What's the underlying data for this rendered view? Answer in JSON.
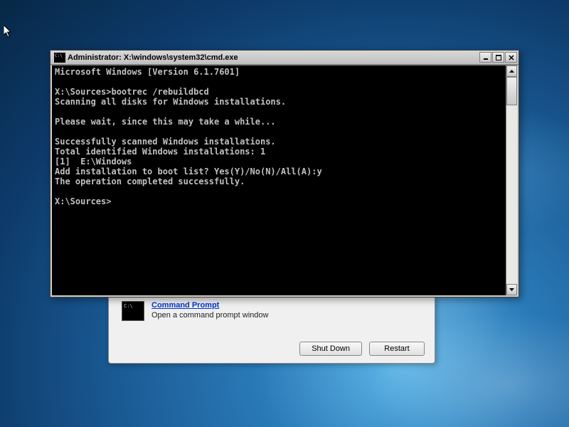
{
  "cmd": {
    "title": "Administrator: X:\\windows\\system32\\cmd.exe",
    "lines": [
      "Microsoft Windows [Version 6.1.7601]",
      "",
      "X:\\Sources>bootrec /rebuildbcd",
      "Scanning all disks for Windows installations.",
      "",
      "Please wait, since this may take a while...",
      "",
      "Successfully scanned Windows installations.",
      "Total identified Windows installations: 1",
      "[1]  E:\\Windows",
      "Add installation to boot list? Yes(Y)/No(N)/All(A):y",
      "The operation completed successfully.",
      "",
      "X:\\Sources>"
    ]
  },
  "recovery": {
    "link": "Command Prompt",
    "desc": "Open a command prompt window",
    "btn_shutdown": "Shut Down",
    "btn_restart": "Restart"
  }
}
